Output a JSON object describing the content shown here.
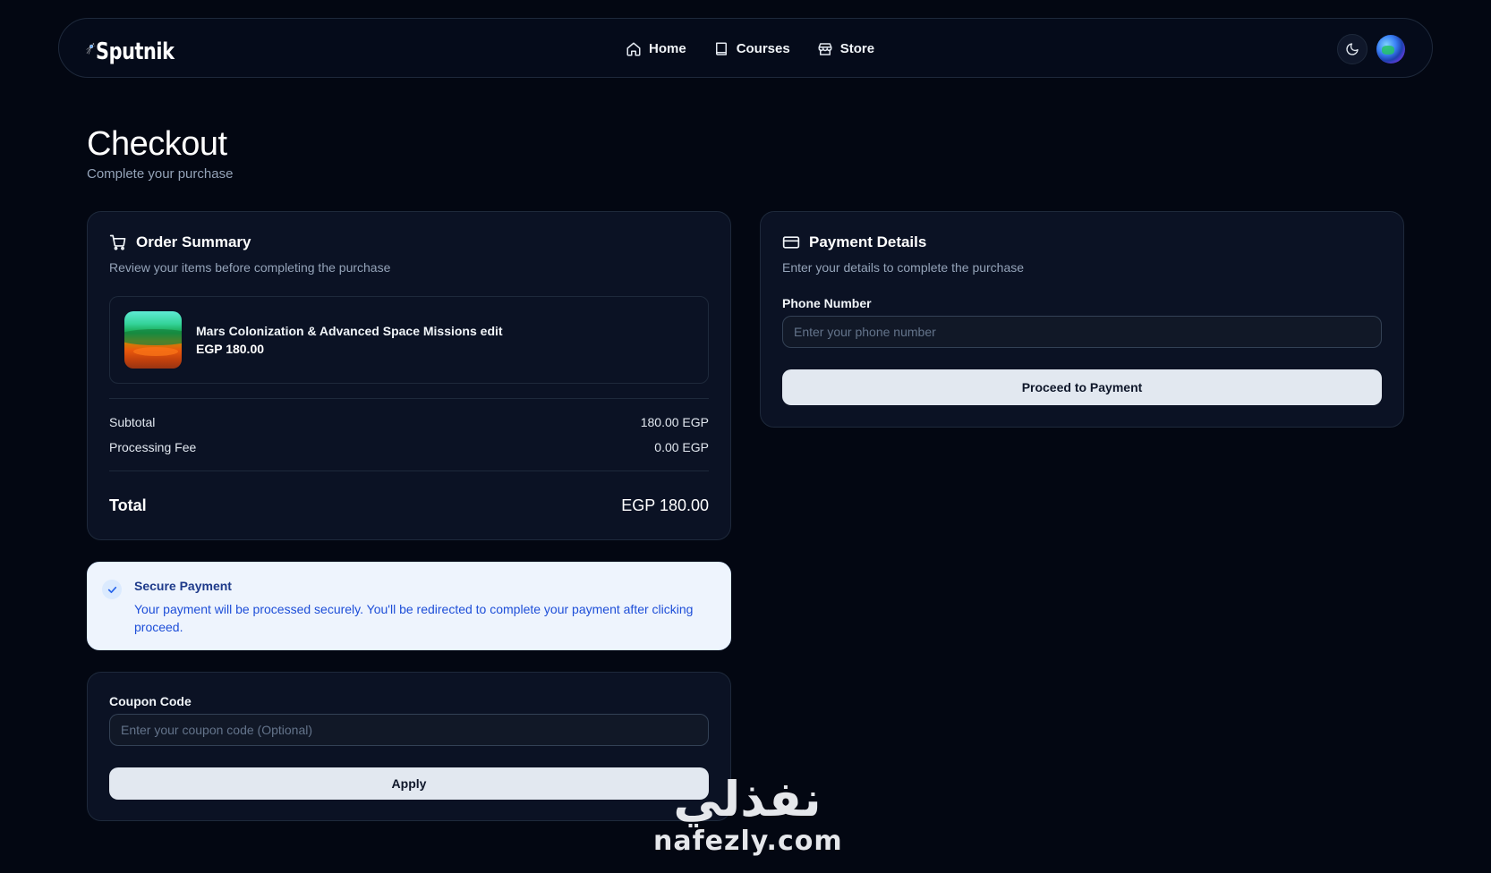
{
  "brand": {
    "name": "Sputnik"
  },
  "nav": {
    "items": [
      {
        "label": "Home",
        "icon": "home-icon"
      },
      {
        "label": "Courses",
        "icon": "book-icon"
      },
      {
        "label": "Store",
        "icon": "store-icon"
      }
    ],
    "theme_toggle_icon": "moon-icon"
  },
  "page": {
    "title": "Checkout",
    "subtitle": "Complete your purchase"
  },
  "order_summary": {
    "title": "Order Summary",
    "description": "Review your items before completing the purchase",
    "item": {
      "name": "Mars Colonization & Advanced Space Missions edit",
      "price": "EGP 180.00"
    },
    "subtotal_label": "Subtotal",
    "subtotal_value": "180.00 EGP",
    "fee_label": "Processing Fee",
    "fee_value": "0.00 EGP",
    "total_label": "Total",
    "total_value": "EGP 180.00"
  },
  "secure_payment": {
    "title": "Secure Payment",
    "text": "Your payment will be processed securely. You'll be redirected to complete your payment after clicking proceed."
  },
  "coupon": {
    "label": "Coupon Code",
    "placeholder": "Enter your coupon code (Optional)",
    "button": "Apply"
  },
  "payment": {
    "title": "Payment Details",
    "description": "Enter your details to complete the purchase",
    "phone_label": "Phone Number",
    "phone_placeholder": "Enter your phone number",
    "button": "Proceed to Payment"
  },
  "watermark": {
    "arabic": "نفذلي",
    "latin": "nafezly.com"
  },
  "colors": {
    "background": "#030712",
    "card": "#0b1224",
    "border": "#1e293b",
    "secure_bg": "#eef4fd",
    "secure_text": "#1d4ed8",
    "button_light": "#e2e8f0"
  }
}
